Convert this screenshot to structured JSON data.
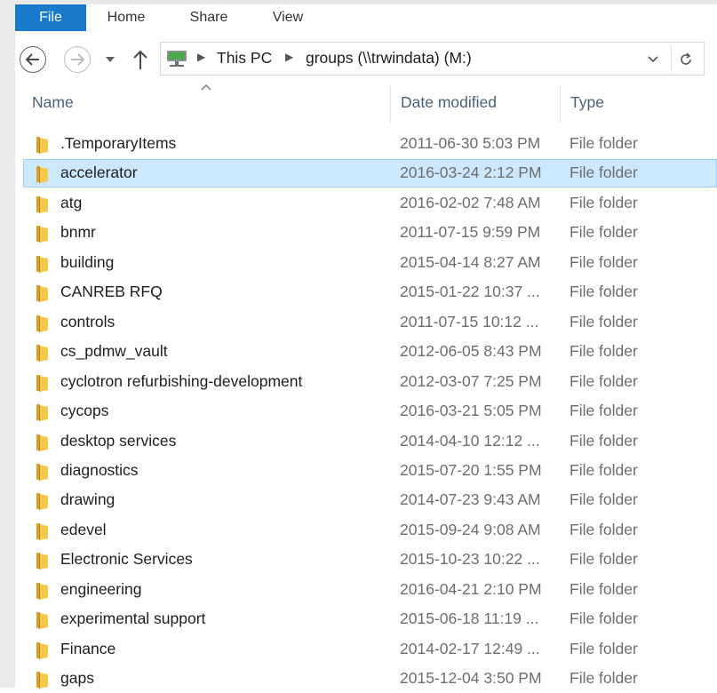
{
  "ribbon": {
    "tabs": [
      "File",
      "Home",
      "Share",
      "View"
    ]
  },
  "address": {
    "crumbs": [
      "This PC",
      "groups (\\\\trwindata) (M:)"
    ]
  },
  "columns": {
    "name": "Name",
    "date": "Date modified",
    "type": "Type"
  },
  "colors": {
    "accent": "#1979ca",
    "selection": "#cce8ff",
    "selection_border": "#99d1ff",
    "folder": "#e8b840"
  },
  "rows": [
    {
      "name": ".TemporaryItems",
      "date": "2011-06-30 5:03 PM",
      "type": "File folder"
    },
    {
      "name": "accelerator",
      "date": "2016-03-24 2:12 PM",
      "type": "File folder",
      "selected": true
    },
    {
      "name": "atg",
      "date": "2016-02-02 7:48 AM",
      "type": "File folder"
    },
    {
      "name": "bnmr",
      "date": "2011-07-15 9:59 PM",
      "type": "File folder"
    },
    {
      "name": "building",
      "date": "2015-04-14 8:27 AM",
      "type": "File folder"
    },
    {
      "name": "CANREB RFQ",
      "date": "2015-01-22 10:37 ...",
      "type": "File folder"
    },
    {
      "name": "controls",
      "date": "2011-07-15 10:12 ...",
      "type": "File folder"
    },
    {
      "name": "cs_pdmw_vault",
      "date": "2012-06-05 8:43 PM",
      "type": "File folder"
    },
    {
      "name": "cyclotron refurbishing-development",
      "date": "2012-03-07 7:25 PM",
      "type": "File folder"
    },
    {
      "name": "cycops",
      "date": "2016-03-21 5:05 PM",
      "type": "File folder"
    },
    {
      "name": "desktop services",
      "date": "2014-04-10 12:12 ...",
      "type": "File folder"
    },
    {
      "name": "diagnostics",
      "date": "2015-07-20 1:55 PM",
      "type": "File folder"
    },
    {
      "name": "drawing",
      "date": "2014-07-23 9:43 AM",
      "type": "File folder"
    },
    {
      "name": "edevel",
      "date": "2015-09-24 9:08 AM",
      "type": "File folder"
    },
    {
      "name": "Electronic Services",
      "date": "2015-10-23 10:22 ...",
      "type": "File folder"
    },
    {
      "name": "engineering",
      "date": "2016-04-21 2:10 PM",
      "type": "File folder"
    },
    {
      "name": "experimental support",
      "date": "2015-06-18 11:19 ...",
      "type": "File folder"
    },
    {
      "name": "Finance",
      "date": "2014-02-17 12:49 ...",
      "type": "File folder"
    },
    {
      "name": "gaps",
      "date": "2015-12-04 3:50 PM",
      "type": "File folder"
    }
  ]
}
